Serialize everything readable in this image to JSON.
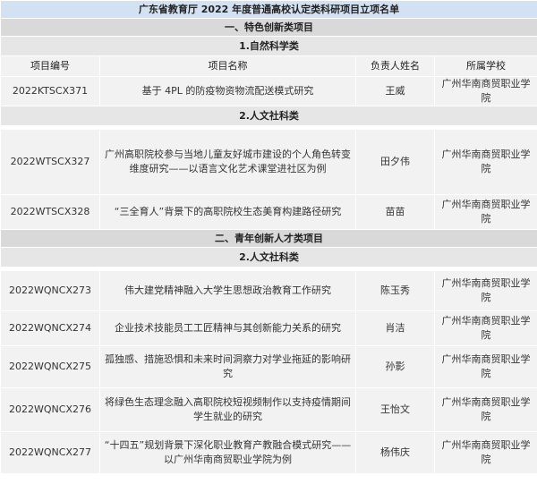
{
  "title": "广东省教育厅 2022 年度普通高校认定类科研项目立项名单",
  "headers": {
    "code": "项目编号",
    "name": "项目名称",
    "leader": "负责人姓名",
    "school": "所属学校"
  },
  "section1": {
    "title": "一、特色创新类项目",
    "cat1": {
      "title": "1.自然科学类",
      "rows": [
        {
          "code": "2022KTSCX371",
          "name": "基于 4PL 的防疫物资物流配送模式研究",
          "leader": "王威",
          "school": "广州华南商贸职业学院"
        }
      ]
    },
    "cat2": {
      "title": "2.人文社科类",
      "rows": [
        {
          "code": "2022WTSCX327",
          "name": "广州高职院校参与当地儿童友好城市建设的个人角色转变维度研究——以语言文化艺术课堂进社区为例",
          "leader": "田夕伟",
          "school": "广州华南商贸职业学院"
        },
        {
          "code": "2022WTSCX328",
          "name": "“三全育人”背景下的高职院校生态美育构建路径研究",
          "leader": "苗苗",
          "school": "广州华南商贸职业学院"
        }
      ]
    }
  },
  "section2": {
    "title": "二、青年创新人才类项目",
    "cat1": {
      "title": "2.人文社科类",
      "rows": [
        {
          "code": "2022WQNCX273",
          "name": "伟大建党精神融入大学生思想政治教育工作研究",
          "leader": "陈玉秀",
          "school": "广州华南商贸职业学院"
        },
        {
          "code": "2022WQNCX274",
          "name": "企业技术技能员工工匠精神与其创新能力关系的研究",
          "leader": "肖洁",
          "school": "广州华南商贸职业学院"
        },
        {
          "code": "2022WQNCX275",
          "name": "孤独感、措施恐惧和未来时间洞察力对学业拖延的影响研究",
          "leader": "孙影",
          "school": "广州华南商贸职业学院"
        },
        {
          "code": "2022WQNCX276",
          "name": "将绿色生态理念融入高职院校短视频制作以支持疫情期间学生就业的研究",
          "leader": "王怡文",
          "school": "广州华南商贸职业学院"
        },
        {
          "code": "2022WQNCX277",
          "name": "“十四五”规划背景下深化职业教育产教融合模式研究——以广州华南商贸职业学院为例",
          "leader": "杨伟庆",
          "school": "广州华南商贸职业学院"
        }
      ]
    }
  }
}
